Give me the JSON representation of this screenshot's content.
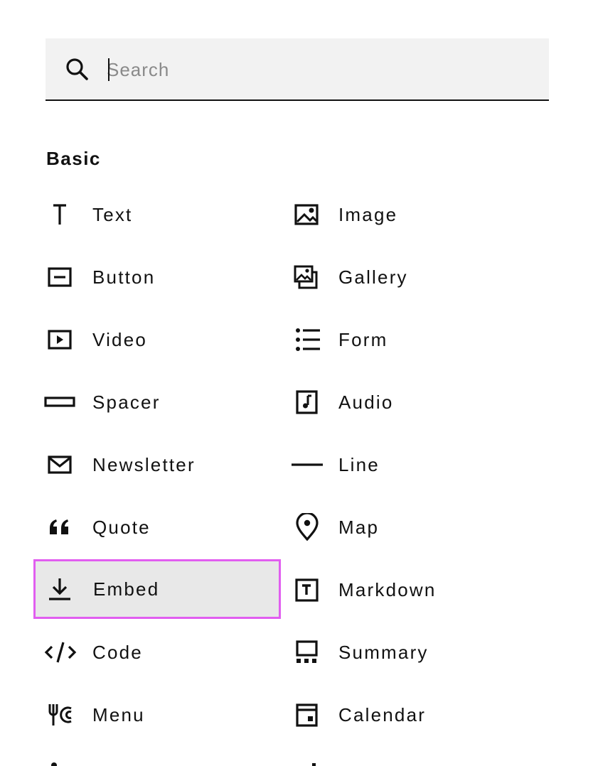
{
  "search": {
    "placeholder": "Search",
    "value": ""
  },
  "section": {
    "title": "Basic"
  },
  "accent_color": "#e15ef0",
  "blocks_left": [
    {
      "label": "Text",
      "icon": "text-icon"
    },
    {
      "label": "Button",
      "icon": "button-icon"
    },
    {
      "label": "Video",
      "icon": "video-icon"
    },
    {
      "label": "Spacer",
      "icon": "spacer-icon"
    },
    {
      "label": "Newsletter",
      "icon": "envelope-icon"
    },
    {
      "label": "Quote",
      "icon": "quote-icon"
    },
    {
      "label": "Embed",
      "icon": "download-icon",
      "selected": true
    },
    {
      "label": "Code",
      "icon": "code-icon"
    },
    {
      "label": "Menu",
      "icon": "fork-icon"
    }
  ],
  "blocks_right": [
    {
      "label": "Image",
      "icon": "image-icon"
    },
    {
      "label": "Gallery",
      "icon": "gallery-icon"
    },
    {
      "label": "Form",
      "icon": "list-icon"
    },
    {
      "label": "Audio",
      "icon": "music-note-icon"
    },
    {
      "label": "Line",
      "icon": "line-icon"
    },
    {
      "label": "Map",
      "icon": "map-pin-icon"
    },
    {
      "label": "Markdown",
      "icon": "markdown-icon"
    },
    {
      "label": "Summary",
      "icon": "summary-icon"
    },
    {
      "label": "Calendar",
      "icon": "calendar-icon"
    }
  ]
}
